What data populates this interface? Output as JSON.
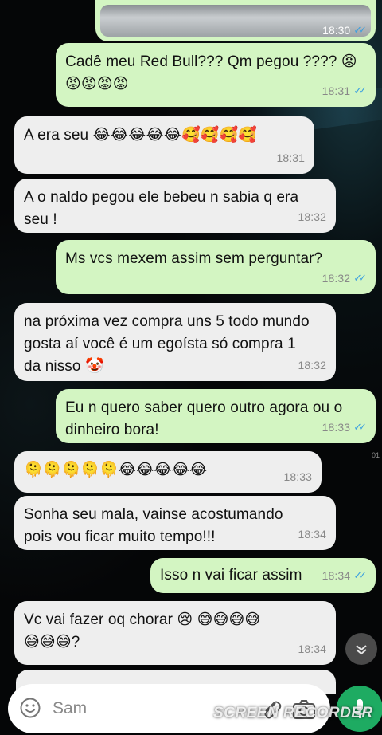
{
  "messages": [
    {
      "dir": "out",
      "text": "Cadê meu Red Bull??? Qm pegou ???? 😡\n😡😡😡😡",
      "time": "18:31",
      "read": true
    },
    {
      "dir": "in",
      "text": "A era seu 😂😂😂😂😂🥰🥰🥰🥰",
      "time": "18:31"
    },
    {
      "dir": "in",
      "text": "A o naldo pegou ele bebeu n sabia q era\nseu !",
      "time": "18:32"
    },
    {
      "dir": "out",
      "text": "Ms vcs mexem assim sem perguntar?",
      "time": "18:32",
      "read": true
    },
    {
      "dir": "in",
      "text": "na próxima vez compra uns 5 todo mundo\ngosta aí você é um egoísta só compra 1\nda nisso 🤡",
      "time": "18:32"
    },
    {
      "dir": "out",
      "text": "Eu n quero saber quero outro agora ou o\ndinheiro bora!",
      "time": "18:33",
      "read": true
    },
    {
      "dir": "in",
      "text": "🫠🫠🫠🫠🫠😂😂😂😂😂",
      "time": "18:33"
    },
    {
      "dir": "in",
      "text": "Sonha seu mala, vainse acostumando\npois vou ficar muito tempo!!!",
      "time": "18:34"
    },
    {
      "dir": "out",
      "text": "Isso n vai ficar assim",
      "time": "18:34",
      "read": true
    },
    {
      "dir": "in",
      "text": "Vc vai fazer oq chorar 😢 😅😅😅😅\n😅😅😅?",
      "time": "18:34"
    }
  ],
  "image_message": {
    "time": "18:30",
    "read": true
  },
  "input": {
    "placeholder": "Sam"
  },
  "icons": {
    "emoji": "emoji-icon",
    "attach": "paperclip-icon",
    "camera": "camera-icon",
    "mic": "microphone-icon",
    "scroll": "chevron-down-icon"
  },
  "watermark": "SCREEN RECORDER",
  "edge_marker": "01",
  "colors": {
    "outgoing_bubble": "#d3f5c2",
    "incoming_bubble": "#eeeeee",
    "read_ticks": "#3a9fe0",
    "mic_button": "#1eab62"
  }
}
